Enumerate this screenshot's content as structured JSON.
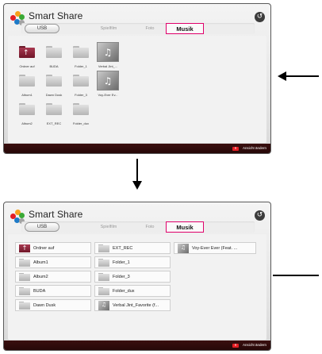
{
  "app": {
    "title": "Smart Share",
    "back_icon": "back-icon"
  },
  "tabs": {
    "usb": "USB",
    "spielfilm": "Spielfilm",
    "foto": "Foto",
    "musik": "Musik"
  },
  "footer": {
    "key_label": "",
    "action_label": "Ansicht ändern",
    "key_color": "#e31e24"
  },
  "colors": {
    "accent": "#e0006b",
    "footer_bg": "#2e0b0b"
  },
  "grid_view": {
    "row1": [
      {
        "label": "Ordner auf",
        "icon": "up-folder-icon"
      },
      {
        "label": "BUDA",
        "icon": "folder-icon"
      },
      {
        "label": "Folder_1",
        "icon": "folder-icon"
      },
      {
        "label": "Verbal Jint_...",
        "icon": "music-thumbnail-icon"
      }
    ],
    "row2": [
      {
        "label": "Album1",
        "icon": "folder-icon"
      },
      {
        "label": "Dawn Dusk",
        "icon": "folder-icon"
      },
      {
        "label": "Folder_3",
        "icon": "folder-icon"
      },
      {
        "label": "Voy-Ever Ev...",
        "icon": "music-thumbnail-icon"
      }
    ],
    "row3": [
      {
        "label": "Album2",
        "icon": "folder-icon"
      },
      {
        "label": "EXT_REC",
        "icon": "folder-icon"
      },
      {
        "label": "Folder_dux",
        "icon": "folder-icon"
      }
    ]
  },
  "list_view": {
    "col1": [
      "Ordner auf",
      "Album1",
      "Album2",
      "BUDA",
      "Dawn Dusk"
    ],
    "col2": [
      "EXT_REC",
      "Folder_1",
      "Folder_3",
      "Folder_dux",
      "Verbal Jint_Favorite (f..."
    ],
    "col3": [
      "Voy-Ever Ever (Feat. ..."
    ]
  },
  "arrows": {
    "right_arrow": "arrow-left-icon",
    "down_arrow": "arrow-down-icon",
    "line": "pointer-line"
  }
}
